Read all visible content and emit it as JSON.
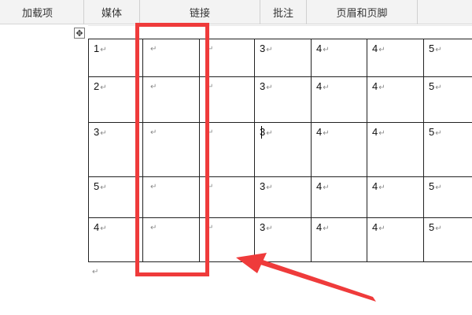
{
  "ribbon": {
    "groups": [
      "加载项",
      "媒体",
      "链接",
      "批注",
      "页眉和页脚"
    ]
  },
  "table": {
    "move_handle_icon": "move-cross-icon",
    "rows": [
      [
        "1",
        "",
        "",
        "3",
        "4",
        "4",
        "5"
      ],
      [
        "2",
        "",
        "",
        "3",
        "4",
        "4",
        "5"
      ],
      [
        "3",
        "",
        "",
        "3",
        "4",
        "4",
        "5"
      ],
      [
        "5",
        "",
        "",
        "3",
        "4",
        "4",
        "5"
      ],
      [
        "4",
        "",
        "",
        "3",
        "4",
        "4",
        "5"
      ]
    ],
    "cell_mark": "↵"
  },
  "paragraph_mark": "↵",
  "annotation": {
    "highlight_color": "#ef3b3b",
    "arrow_color": "#ef3b3b"
  }
}
